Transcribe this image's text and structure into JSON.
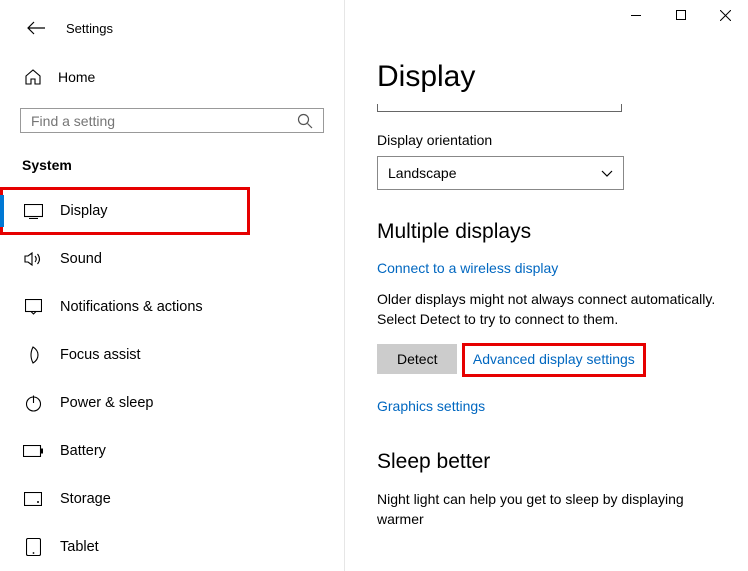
{
  "window": {
    "title": "Settings"
  },
  "sidebar": {
    "home_label": "Home",
    "search_placeholder": "Find a setting",
    "section_label": "System",
    "items": [
      {
        "label": "Display",
        "selected": true,
        "highlight": true
      },
      {
        "label": "Sound"
      },
      {
        "label": "Notifications & actions"
      },
      {
        "label": "Focus assist"
      },
      {
        "label": "Power & sleep"
      },
      {
        "label": "Battery"
      },
      {
        "label": "Storage"
      },
      {
        "label": "Tablet"
      }
    ]
  },
  "content": {
    "page_title": "Display",
    "orientation": {
      "label": "Display orientation",
      "value": "Landscape"
    },
    "multiple_displays": {
      "heading": "Multiple displays",
      "wireless_link": "Connect to a wireless display",
      "desc": "Older displays might not always connect automatically. Select Detect to try to connect to them.",
      "detect_button": "Detect",
      "advanced_link": "Advanced display settings",
      "graphics_link": "Graphics settings"
    },
    "sleep_better": {
      "heading": "Sleep better",
      "desc": "Night light can help you get to sleep by displaying warmer"
    }
  }
}
